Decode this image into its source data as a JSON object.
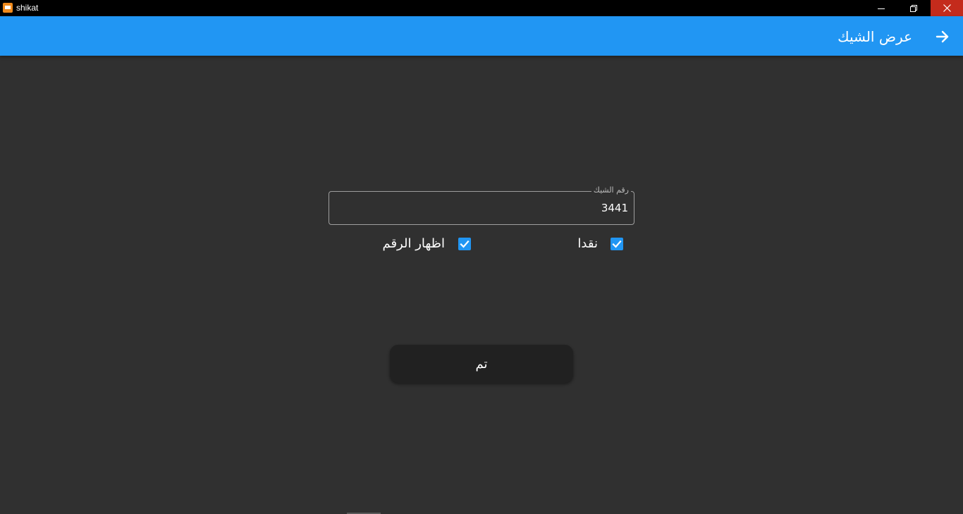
{
  "window": {
    "title": "shikat",
    "icons": {
      "app": "app-window-icon",
      "minimize": "minimize-icon",
      "restore": "restore-icon",
      "close": "close-icon"
    }
  },
  "appbar": {
    "title": "عرض الشيك",
    "back_icon": "arrow-forward-icon",
    "color": "#2196f3"
  },
  "form": {
    "check_number": {
      "label": "رقم الشيك",
      "value": "3441"
    },
    "cash": {
      "label": "نقدا",
      "checked": true
    },
    "show_number": {
      "label": "اظهار الرقم",
      "checked": true
    },
    "done_label": "تم"
  },
  "colors": {
    "background": "#303030",
    "accent": "#2196f3",
    "close_button": "#c42b1c"
  }
}
